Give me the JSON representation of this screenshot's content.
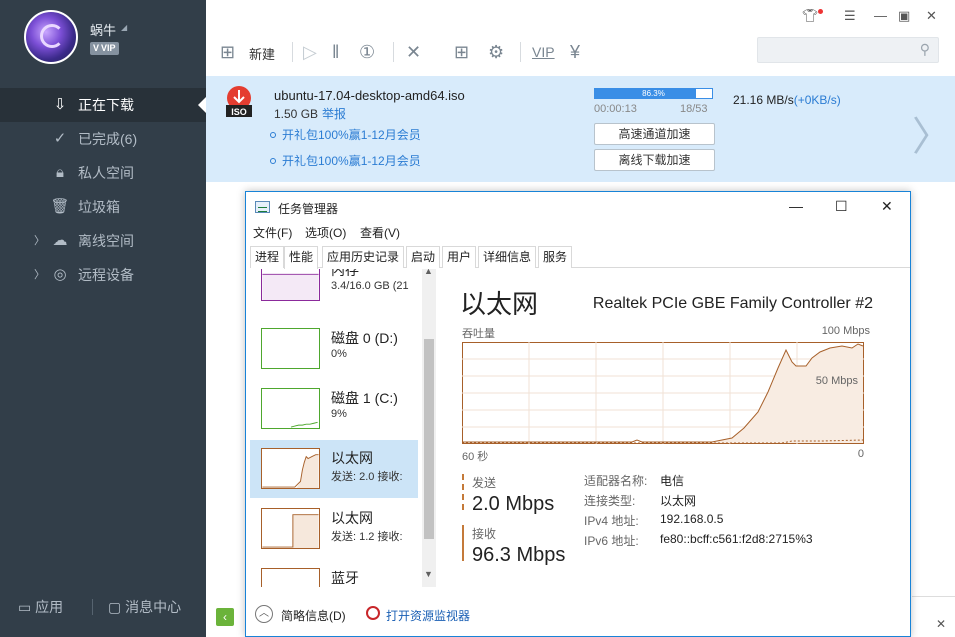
{
  "sidebar": {
    "username": "蜗牛",
    "vip": "VIP",
    "nav": [
      {
        "label": "正在下载",
        "icon": "download-icon",
        "active": true
      },
      {
        "label": "已完成(6)",
        "icon": "check-circle-icon"
      },
      {
        "label": "私人空间",
        "icon": "lock-icon"
      },
      {
        "label": "垃圾箱",
        "icon": "trash-icon"
      },
      {
        "label": "离线空间",
        "icon": "cloud-icon"
      },
      {
        "label": "远程设备",
        "icon": "globe-icon"
      }
    ],
    "bottom_app": "应用",
    "bottom_msg": "消息中心"
  },
  "toolbar": {
    "new_label": "新建",
    "search_placeholder": ""
  },
  "download": {
    "file_name": "ubuntu-17.04-desktop-amd64.iso",
    "file_icon_label": "ISO",
    "size": "1.50 GB",
    "report": "举报",
    "progress_text": "86.3%",
    "progress_fraction": 0.863,
    "elapsed": "00:00:13",
    "pieces": "18/53",
    "promo1": "开礼包100%赢1-12月会员",
    "promo2": "开礼包100%赢1-12月会员",
    "btn_high_speed": "高速通道加速",
    "btn_offline": "离线下载加速",
    "speed": "21.16  MB/s",
    "speed_extra": "(+0KB/s)"
  },
  "task_manager": {
    "title": "任务管理器",
    "menu": [
      "文件(F)",
      "选项(O)",
      "查看(V)"
    ],
    "tabs": [
      "进程",
      "性能",
      "应用历史记录",
      "启动",
      "用户",
      "详细信息",
      "服务"
    ],
    "active_tab": 1,
    "perf_items": [
      {
        "title": "内存",
        "sub": "3.4/16.0 GB (21"
      },
      {
        "title": "磁盘 0 (D:)",
        "sub": "0%"
      },
      {
        "title": "磁盘 1 (C:)",
        "sub": "9%"
      },
      {
        "title": "以太网",
        "sub": "发送: 2.0  接收:"
      },
      {
        "title": "以太网",
        "sub": "发送: 1.2  接收:"
      },
      {
        "title": "蓝牙",
        "sub": ""
      }
    ],
    "detail": {
      "title": "以太网",
      "adapter": "Realtek PCIe GBE Family Controller #2",
      "throughput_label": "吞吐量",
      "max_label": "100 Mbps",
      "mid_label": "50 Mbps",
      "time_left": "60 秒",
      "time_right": "0",
      "send_label": "发送",
      "send_value": "2.0 Mbps",
      "recv_label": "接收",
      "recv_value": "96.3 Mbps",
      "info": [
        {
          "label": "适配器名称:",
          "value": "电信"
        },
        {
          "label": "连接类型:",
          "value": "以太网"
        },
        {
          "label": "IPv4 地址:",
          "value": "192.168.0.5"
        },
        {
          "label": "IPv6 地址:",
          "value": "fe80::bcff:c561:f2d8:2715%3"
        }
      ]
    },
    "footer_fewer": "简略信息(D)",
    "footer_resmon": "打开资源监视器",
    "colors": {
      "net": "#a7602a",
      "disk": "#4ea72e",
      "mem": "#8b2a9b"
    }
  }
}
